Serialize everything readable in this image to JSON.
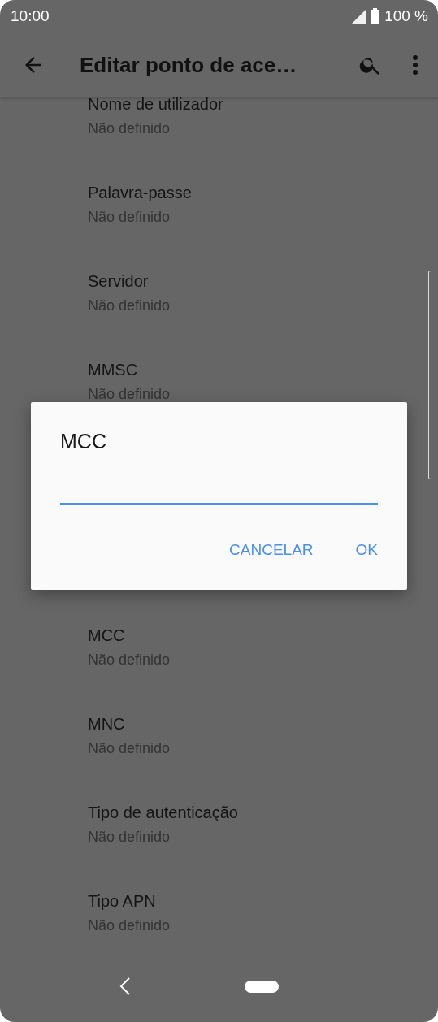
{
  "status_bar": {
    "time": "10:00",
    "battery": "100 %"
  },
  "toolbar": {
    "title": "Editar ponto de ace…"
  },
  "settings_above": [
    {
      "title": "Nome de utilizador",
      "value": "Não definido"
    },
    {
      "title": "Palavra-passe",
      "value": "Não definido"
    },
    {
      "title": "Servidor",
      "value": "Não definido"
    },
    {
      "title": "MMSC",
      "value": "Não definido"
    }
  ],
  "settings_below": [
    {
      "title": "MCC",
      "value": "Não definido"
    },
    {
      "title": "MNC",
      "value": "Não definido"
    },
    {
      "title": "Tipo de autenticação",
      "value": "Não definido"
    },
    {
      "title": "Tipo APN",
      "value": "Não definido"
    }
  ],
  "dialog": {
    "title": "MCC",
    "buttons": [
      "CANCELAR",
      "OK"
    ]
  }
}
